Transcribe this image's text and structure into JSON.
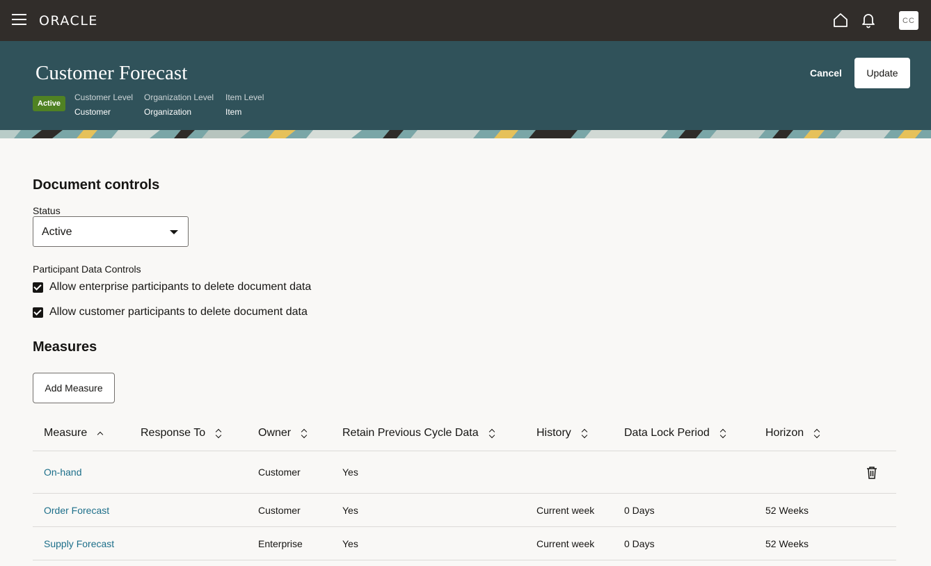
{
  "topbar": {
    "logo": "ORACLE",
    "avatar_initials": "CC",
    "icons": [
      "menu-icon",
      "home-icon",
      "bell-icon"
    ]
  },
  "header": {
    "title": "Customer Forecast",
    "status_badge": "Active",
    "meta": [
      {
        "key": "Customer Level",
        "value": "Customer"
      },
      {
        "key": "Organization Level",
        "value": "Organization"
      },
      {
        "key": "Item Level",
        "value": "Item"
      }
    ],
    "cancel_label": "Cancel",
    "update_label": "Update"
  },
  "document_controls": {
    "heading": "Document controls",
    "status_label": "Status",
    "status_value": "Active",
    "participant_label": "Participant Data Controls",
    "checkboxes": [
      {
        "label": "Allow enterprise participants to delete document data",
        "checked": true
      },
      {
        "label": "Allow customer participants to delete document data",
        "checked": true
      }
    ]
  },
  "measures": {
    "heading": "Measures",
    "add_label": "Add Measure",
    "columns": [
      "Measure",
      "Response To",
      "Owner",
      "Retain Previous Cycle Data",
      "History",
      "Data Lock Period",
      "Horizon"
    ],
    "rows": [
      {
        "measure": "On-hand",
        "response_to": "",
        "owner": "Customer",
        "retain": "Yes",
        "history": "",
        "lock": "",
        "horizon": ""
      },
      {
        "measure": "Order Forecast",
        "response_to": "",
        "owner": "Customer",
        "retain": "Yes",
        "history": "Current week",
        "lock": "0 Days",
        "horizon": "52 Weeks"
      },
      {
        "measure": "Supply Forecast",
        "response_to": "",
        "owner": "Enterprise",
        "retain": "Yes",
        "history": "Current week",
        "lock": "0 Days",
        "horizon": "52 Weeks"
      }
    ]
  },
  "colors": {
    "topbar": "#312d2a",
    "header": "#30525a",
    "badge": "#508223",
    "link": "#1d6f8a"
  }
}
